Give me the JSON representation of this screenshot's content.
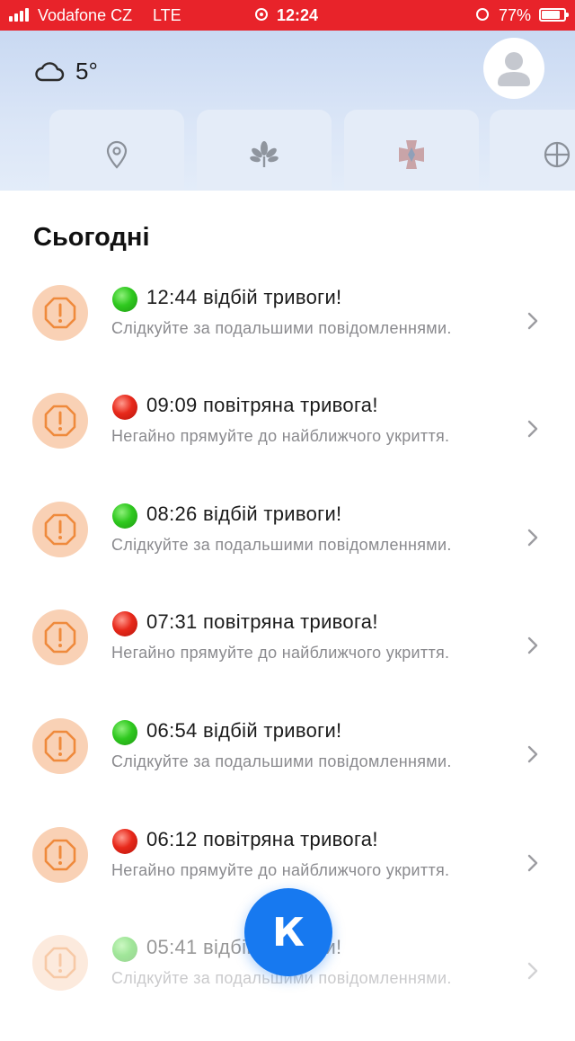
{
  "status_bar": {
    "carrier": "Vodafone CZ",
    "network": "LTE",
    "time": "12:24",
    "battery": "77%",
    "background_color": "#e8232a"
  },
  "header": {
    "weather_icon": "cloud-icon",
    "temperature": "5°",
    "profile_icon": "user-avatar-icon",
    "quick_actions": [
      {
        "icon": "location-pin-icon"
      },
      {
        "icon": "chestnut-leaf-icon"
      },
      {
        "icon": "military-emblem-icon"
      },
      {
        "icon": "crosshair-icon"
      }
    ]
  },
  "section": {
    "title": "Сьогодні"
  },
  "alerts": [
    {
      "status": "green",
      "title": "12:44 відбій тривоги!",
      "message": "Слідкуйте за подальшими повідомленнями."
    },
    {
      "status": "red",
      "title": "09:09 повітряна тривога!",
      "message": "Негайно прямуйте до найближчого укриття."
    },
    {
      "status": "green",
      "title": "08:26 відбій тривоги!",
      "message": "Слідкуйте за подальшими повідомленнями."
    },
    {
      "status": "red",
      "title": "07:31 повітряна тривога!",
      "message": "Негайно прямуйте до найближчого укриття."
    },
    {
      "status": "green",
      "title": "06:54 відбій тривоги!",
      "message": "Слідкуйте за подальшими повідомленнями."
    },
    {
      "status": "red",
      "title": "06:12 повітряна тривога!",
      "message": "Негайно прямуйте до найближчого укриття."
    },
    {
      "status": "green",
      "title": "05:41 відбій тривоги!",
      "message": "Слідкуйте за подальшими повідомленнями."
    }
  ],
  "fab": {
    "label": "К",
    "color": "#1779f0"
  },
  "colors": {
    "alert_icon_bg": "#f9d1b5",
    "alert_icon_fg": "#ef8a3c",
    "green_dot": "#2fc91f",
    "red_dot": "#e8291b"
  }
}
